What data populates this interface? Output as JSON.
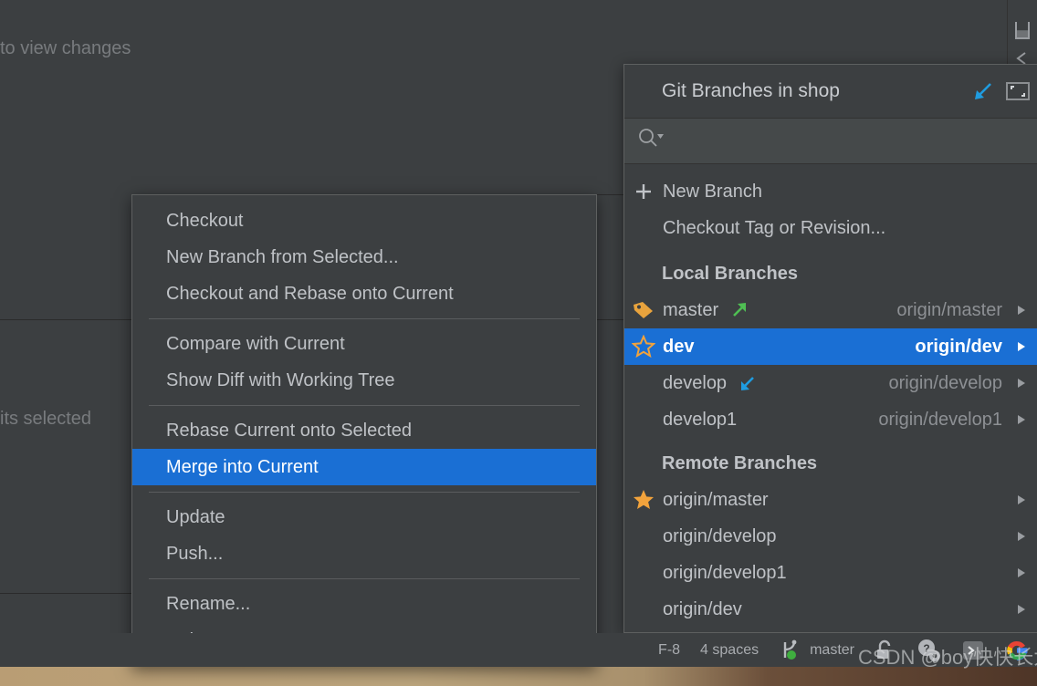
{
  "background": {
    "editor_hint_text": "to view changes",
    "commits_selected_text": "its selected"
  },
  "right_toolbar": {
    "icons": [
      {
        "name": "save-icon",
        "glyph": "save"
      },
      {
        "name": "collapse-left-icon",
        "glyph": "<"
      }
    ]
  },
  "branches_popup": {
    "title": "Git Branches in shop",
    "header_buttons": [
      {
        "name": "pin-popup-button",
        "glyph": "arrow-down-left",
        "color": "#1f9ce0"
      },
      {
        "name": "restore-window-button",
        "glyph": "restore",
        "color": "#8b8e91"
      }
    ],
    "search": {
      "placeholder": "",
      "value": "",
      "icon": "search-icon"
    },
    "actions": [
      {
        "label": "New Branch",
        "icon": "plus-icon"
      },
      {
        "label": "Checkout Tag or Revision...",
        "icon": "none"
      }
    ],
    "local_section_title": "Local Branches",
    "local_branches": [
      {
        "name": "master",
        "tracking": "origin/master",
        "icon": "tag-icon",
        "icon_color": "#e8a33d",
        "state_icon": "arrow-up-right-icon",
        "state_color": "#4fbf53",
        "selected": false,
        "has_submenu": true
      },
      {
        "name": "dev",
        "tracking": "origin/dev",
        "icon": "star-outline-icon",
        "icon_color": "#f2a33c",
        "state_icon": "none",
        "state_color": "",
        "selected": true,
        "has_submenu": true
      },
      {
        "name": "develop",
        "tracking": "origin/develop",
        "icon": "none",
        "icon_color": "",
        "state_icon": "arrow-down-left-icon",
        "state_color": "#1f9ce0",
        "selected": false,
        "has_submenu": true
      },
      {
        "name": "develop1",
        "tracking": "origin/develop1",
        "icon": "none",
        "icon_color": "",
        "state_icon": "none",
        "state_color": "",
        "selected": false,
        "has_submenu": true
      }
    ],
    "remote_section_title": "Remote Branches",
    "remote_branches": [
      {
        "name": "origin/master",
        "icon": "star-filled-icon",
        "icon_color": "#f2a33c",
        "has_submenu": true
      },
      {
        "name": "origin/develop",
        "icon": "none",
        "icon_color": "",
        "has_submenu": true
      },
      {
        "name": "origin/develop1",
        "icon": "none",
        "icon_color": "",
        "has_submenu": true
      },
      {
        "name": "origin/dev",
        "icon": "none",
        "icon_color": "",
        "has_submenu": true
      }
    ]
  },
  "context_menu": {
    "groups": [
      {
        "items": [
          {
            "label": "Checkout",
            "highlighted": false
          },
          {
            "label": "New Branch from Selected...",
            "highlighted": false
          },
          {
            "label": "Checkout and Rebase onto Current",
            "highlighted": false
          }
        ]
      },
      {
        "items": [
          {
            "label": "Compare with Current",
            "highlighted": false
          },
          {
            "label": "Show Diff with Working Tree",
            "highlighted": false
          }
        ]
      },
      {
        "items": [
          {
            "label": "Rebase Current onto Selected",
            "highlighted": false
          },
          {
            "label": "Merge into Current",
            "highlighted": true
          }
        ]
      },
      {
        "items": [
          {
            "label": "Update",
            "highlighted": false
          },
          {
            "label": "Push...",
            "highlighted": false
          }
        ]
      },
      {
        "items": [
          {
            "label": "Rename...",
            "highlighted": false
          },
          {
            "label": "Delete",
            "highlighted": false
          }
        ]
      }
    ]
  },
  "status_bar": {
    "encoding": "F-8",
    "indent": "4 spaces",
    "branch": "master",
    "branch_icon": "git-branch-icon",
    "icons": [
      {
        "name": "unlock-icon"
      },
      {
        "name": "help-settings-icon"
      },
      {
        "name": "terminal-icon"
      },
      {
        "name": "google-icon"
      }
    ]
  },
  "watermark": {
    "text": "CSDN @boy快快长大"
  },
  "colors": {
    "selection_blue": "#1a6fd4",
    "panel_bg": "#3c3f41",
    "text": "#bfc2c6",
    "muted_text": "#8d9094",
    "accent_orange": "#f2a33c",
    "accent_green": "#4fbf53",
    "accent_cyan": "#1f9ce0"
  }
}
